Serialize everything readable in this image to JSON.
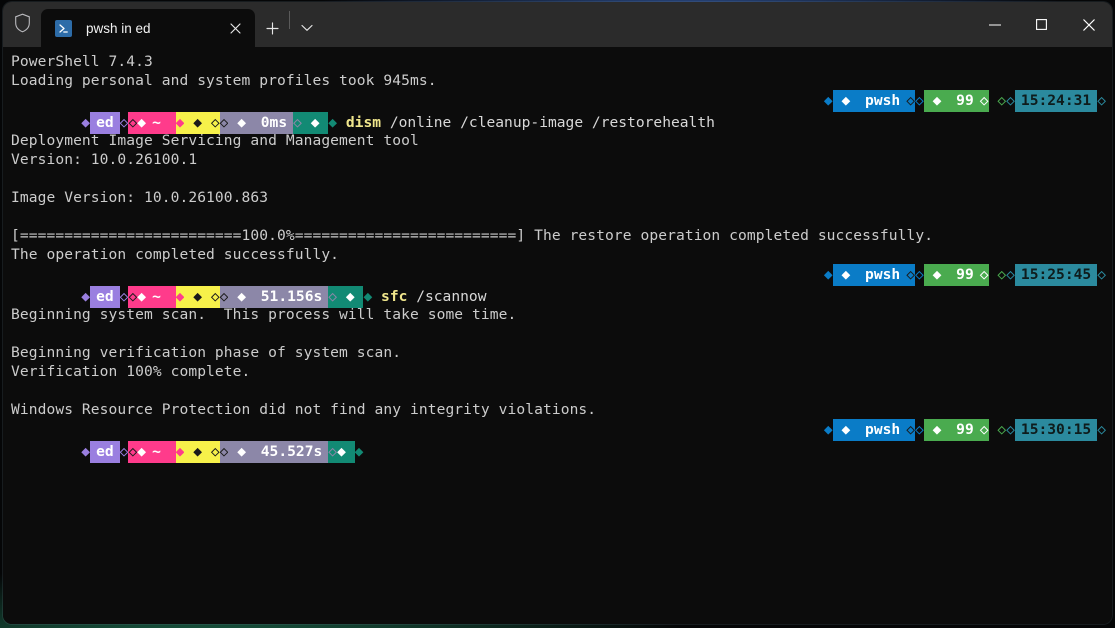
{
  "window": {
    "shield_icon": "shield-icon",
    "tab": {
      "icon": "powershell-icon",
      "title": "pwsh in ed",
      "close_icon": "close-icon"
    },
    "new_tab_icon": "plus-icon",
    "dropdown_icon": "chevron-down-icon",
    "controls": {
      "minimize": "minimize-icon",
      "maximize": "maximize-icon",
      "close": "close-icon"
    }
  },
  "terminal": {
    "banner": [
      "PowerShell 7.4.3",
      "Loading personal and system profiles took 945ms."
    ],
    "prompts": [
      {
        "user": "ed",
        "path": "~",
        "duration": "0ms",
        "command_name": "dism",
        "command_args": "/online /cleanup-image /restorehealth",
        "shell": "pwsh",
        "battery": "99",
        "clock": "15:24:31"
      },
      {
        "user": "ed",
        "path": "~",
        "duration": "51.156s",
        "command_name": "sfc",
        "command_args": "/scannow",
        "shell": "pwsh",
        "battery": "99",
        "clock": "15:25:45"
      },
      {
        "user": "ed",
        "path": "~",
        "duration": "45.527s",
        "command_name": "",
        "command_args": "",
        "shell": "pwsh",
        "battery": "99",
        "clock": "15:30:15"
      }
    ],
    "dism_output": {
      "blank1": " ",
      "tool": "Deployment Image Servicing and Management tool",
      "version": "Version: 10.0.26100.1",
      "blank2": " ",
      "image_version": "Image Version: 10.0.26100.863",
      "blank3": " ",
      "progress_bar": "[=========================100.0%=========================] The restore operation completed successfully.",
      "completed": "The operation completed successfully."
    },
    "sfc_output": {
      "blank1": " ",
      "beginning_scan": "Beginning system scan.  This process will take some time.",
      "blank2": " ",
      "verification_phase": "Beginning verification phase of system scan.",
      "verification_complete": "Verification 100% complete.",
      "blank3": " ",
      "result": "Windows Resource Protection did not find any integrity violations."
    },
    "glyphs": {
      "diamond": "◆",
      "diamond_outline": "◇"
    },
    "colors": {
      "background": "#0c0c0c",
      "foreground": "#cccccc",
      "user_segment": "#9a7fe0",
      "path_segment": "#ff3b8b",
      "git_segment": "#f7f14a",
      "time_segment": "#8c87a8",
      "teal_segment": "#128a74",
      "shell_segment": "#0a7cc7",
      "battery_segment": "#4aab4f",
      "clock_segment": "#2b8a9e",
      "command_name": "#f0e68c"
    }
  }
}
